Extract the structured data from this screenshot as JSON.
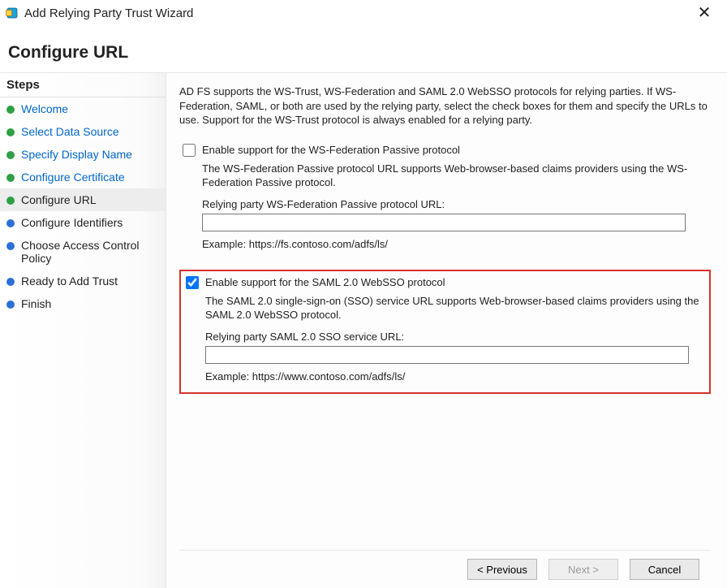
{
  "window": {
    "title": "Add Relying Party Trust Wizard",
    "close_glyph": "✕"
  },
  "page_heading": "Configure URL",
  "sidebar": {
    "title": "Steps",
    "items": [
      {
        "label": "Welcome",
        "state": "done"
      },
      {
        "label": "Select Data Source",
        "state": "done"
      },
      {
        "label": "Specify Display Name",
        "state": "done"
      },
      {
        "label": "Configure Certificate",
        "state": "done"
      },
      {
        "label": "Configure URL",
        "state": "current"
      },
      {
        "label": "Configure Identifiers",
        "state": "todo"
      },
      {
        "label": "Choose Access Control Policy",
        "state": "todo"
      },
      {
        "label": "Ready to Add Trust",
        "state": "todo"
      },
      {
        "label": "Finish",
        "state": "todo"
      }
    ]
  },
  "main": {
    "intro": "AD FS supports the WS-Trust, WS-Federation and SAML 2.0 WebSSO protocols for relying parties.  If WS-Federation, SAML, or both are used by the relying party, select the check boxes for them and specify the URLs to use.  Support for the WS-Trust protocol is always enabled for a relying party.",
    "wsfed": {
      "checkbox_label": "Enable support for the WS-Federation Passive protocol",
      "checked": false,
      "description": "The WS-Federation Passive protocol URL supports Web-browser-based claims providers using the WS-Federation Passive protocol.",
      "url_label": "Relying party WS-Federation Passive protocol URL:",
      "url_value": "",
      "example": "Example: https://fs.contoso.com/adfs/ls/"
    },
    "saml": {
      "checkbox_label": "Enable support for the SAML 2.0 WebSSO protocol",
      "checked": true,
      "description": "The SAML 2.0 single-sign-on (SSO) service URL supports Web-browser-based claims providers using the SAML 2.0 WebSSO protocol.",
      "url_label": "Relying party SAML 2.0 SSO service URL:",
      "url_value": "",
      "example": "Example: https://www.contoso.com/adfs/ls/"
    }
  },
  "buttons": {
    "previous": "< Previous",
    "next": "Next >",
    "cancel": "Cancel"
  }
}
